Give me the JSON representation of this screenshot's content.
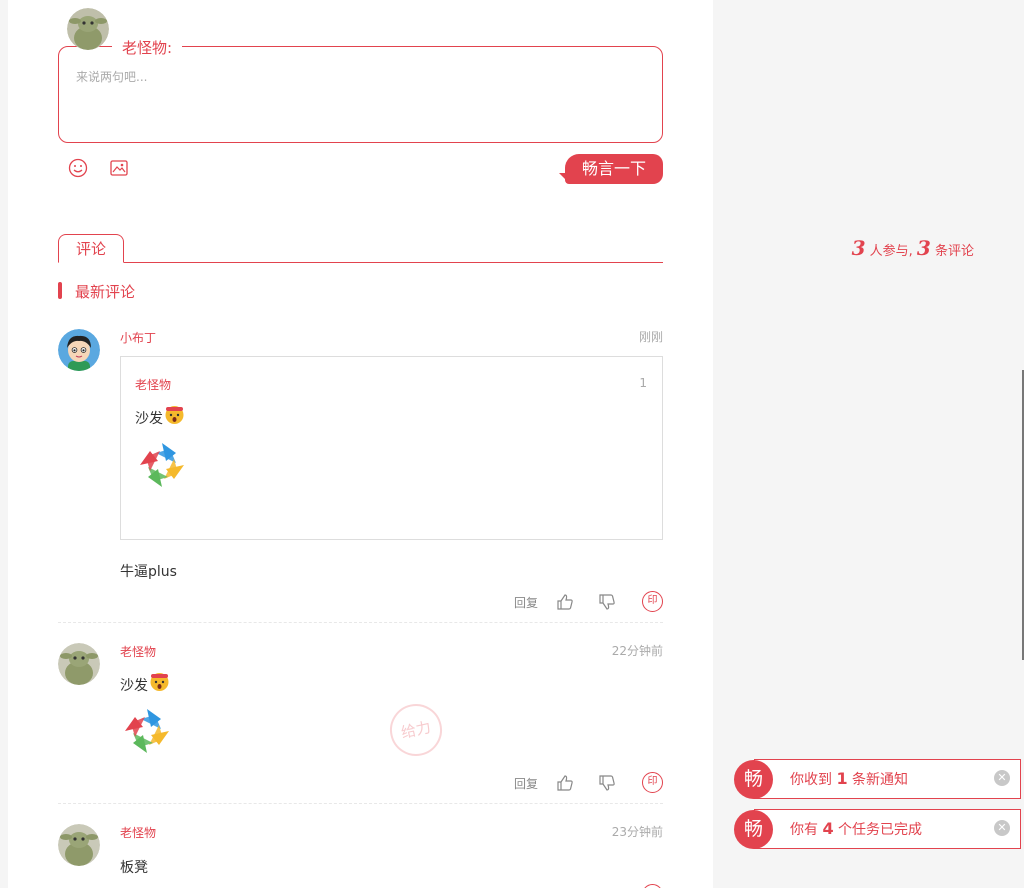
{
  "colors": {
    "accent": "#e2434e",
    "muted": "#aaaaaa"
  },
  "composer": {
    "username": "老怪物:",
    "placeholder": "来说两句吧...",
    "submit_label": "畅言一下",
    "icons": [
      "smiley-icon",
      "image-icon"
    ]
  },
  "tabs": {
    "comment_tab": "评论"
  },
  "stats": {
    "participants": "3",
    "participants_label": "人参与,",
    "comments": "3",
    "comments_label": "条评论"
  },
  "latest": {
    "title": "最新评论"
  },
  "actions": {
    "reply": "回复"
  },
  "comments": [
    {
      "user": "小布丁",
      "time": "刚刚",
      "quote": {
        "user": "老怪物",
        "floor": "1",
        "text": "沙发"
      },
      "text": "牛逼plus"
    },
    {
      "user": "老怪物",
      "time": "22分钟前",
      "text": "沙发"
    },
    {
      "user": "老怪物",
      "time": "23分钟前",
      "text": "板凳"
    }
  ],
  "stamp": {
    "text": "给力"
  },
  "seal": {
    "text": "印"
  },
  "notifications": [
    {
      "badge": "畅",
      "prefix": "你收到",
      "count": "1",
      "suffix": "条新通知"
    },
    {
      "badge": "畅",
      "prefix": "你有",
      "count": "4",
      "suffix": "个任务已完成"
    }
  ]
}
